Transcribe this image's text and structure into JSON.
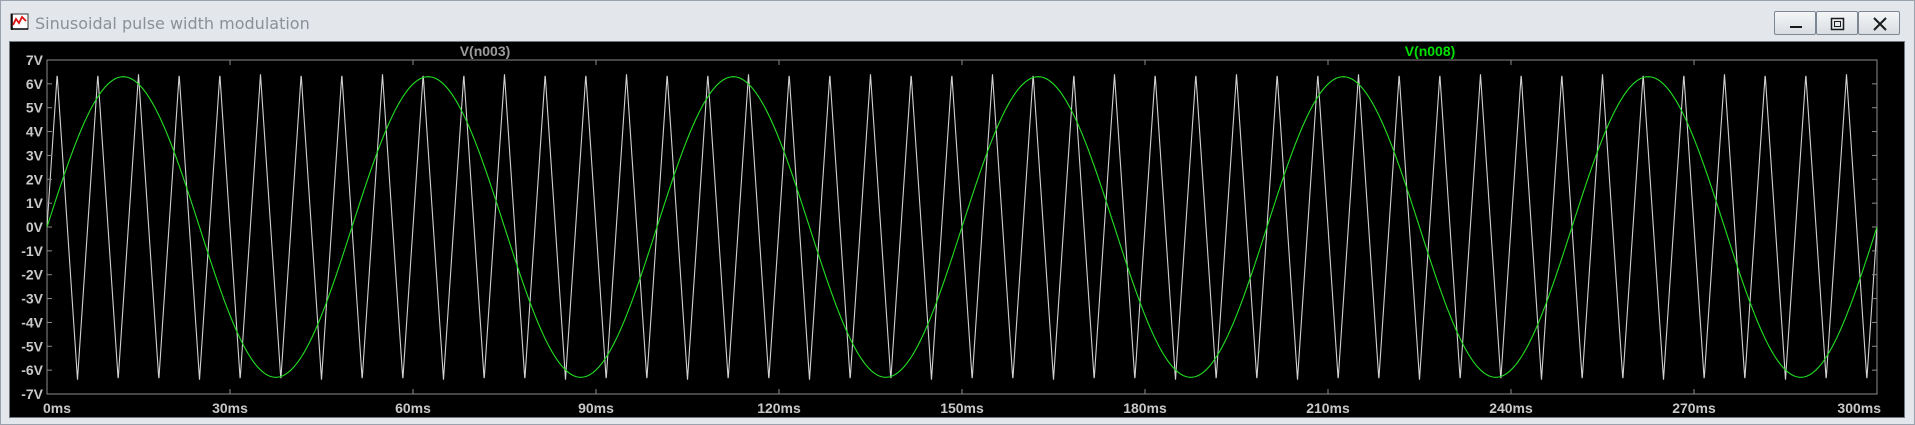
{
  "window": {
    "title": "Sinusoidal pulse width modulation",
    "buttons": {
      "minimize": "minimize",
      "maximize": "maximize",
      "close": "close"
    }
  },
  "colors": {
    "background": "#000000",
    "grid": "#8c8c8c",
    "axis_text": "#c8c8c8",
    "trace_triangle": "#d2d2d2",
    "trace_sine": "#22e022",
    "label_triangle": "#9b9b9b",
    "label_sine": "#00e000"
  },
  "icons": {
    "app": "waveform-app-icon"
  },
  "chart_data": {
    "type": "line",
    "x_unit": "ms",
    "y_unit": "V",
    "xlim": [
      0,
      300
    ],
    "ylim": [
      -7,
      7
    ],
    "grid": false,
    "xticks": [
      "0ms",
      "30ms",
      "60ms",
      "90ms",
      "120ms",
      "150ms",
      "180ms",
      "210ms",
      "240ms",
      "270ms",
      "300ms"
    ],
    "yticks": [
      "7V",
      "6V",
      "5V",
      "4V",
      "3V",
      "2V",
      "1V",
      "0V",
      "-1V",
      "-2V",
      "-3V",
      "-4V",
      "-5V",
      "-6V",
      "-7V"
    ],
    "series": [
      {
        "name": "V(n003)",
        "shape": "triangle",
        "amplitude": 6.4,
        "frequency_hz": 150,
        "phase_offset_ms": 0
      },
      {
        "name": "V(n008)",
        "shape": "sine",
        "amplitude": 6.3,
        "frequency_hz": 20,
        "phase_offset_ms": 0
      }
    ]
  }
}
